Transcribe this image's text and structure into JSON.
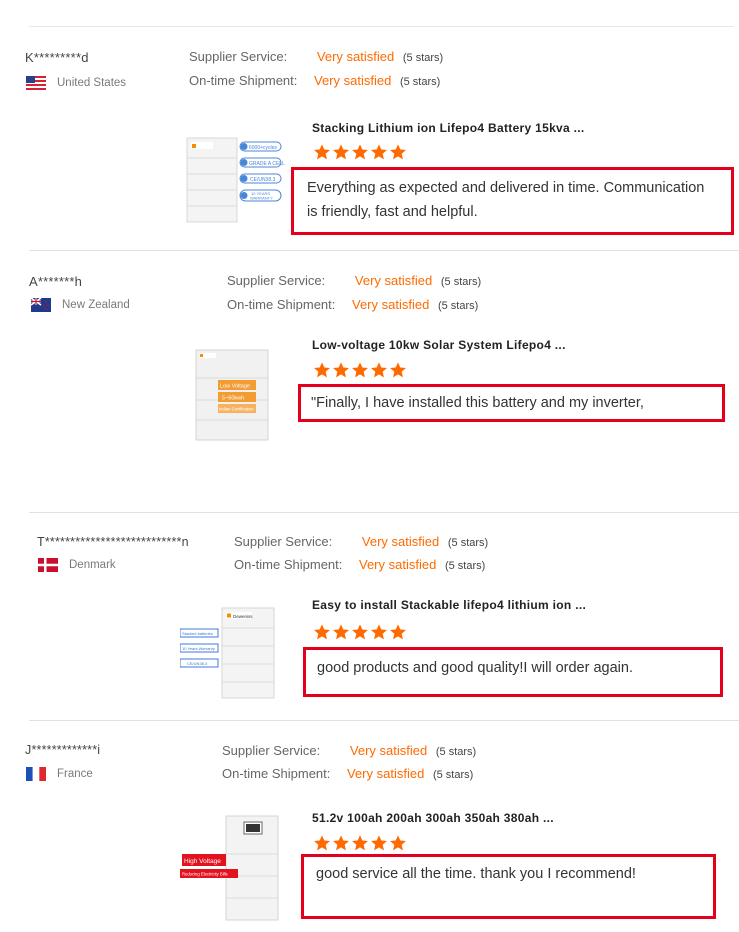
{
  "labels": {
    "supplier_service": "Supplier Service:",
    "ontime_shipment": "On-time Shipment:"
  },
  "colors": {
    "accent": "#ff6a00",
    "highlight_border": "#e4001a"
  },
  "reviews": [
    {
      "user": "K*********d",
      "country": "United States",
      "flag_icon": "us-flag-icon",
      "supplier_service": "Very satisfied",
      "supplier_service_count": "(5 stars)",
      "ontime_shipment": "Very satisfied",
      "ontime_shipment_count": "(5 stars)",
      "product_title": "Stacking Lithium ion Lifepo4 Battery 15kva ...",
      "rating": 5,
      "thumb_badges": [
        "6000+cycles",
        "GRADE A CELL",
        "CE/UN38.3",
        "10 YEARS WARRANTY"
      ],
      "thumb_brand": "Deweniss",
      "review_text": "Everything as expected and delivered in time. Communication is friendly, fast and helpful."
    },
    {
      "user": "A*******h",
      "country": "New Zealand",
      "flag_icon": "nz-flag-icon",
      "supplier_service": "Very satisfied",
      "supplier_service_count": "(5 stars)",
      "ontime_shipment": "Very satisfied",
      "ontime_shipment_count": "(5 stars)",
      "product_title": "Low-voltage 10kw Solar System Lifepo4 ...",
      "rating": 5,
      "thumb_badges": [
        "Low Voltage",
        "5~60kwh",
        "Indian Certification"
      ],
      "review_text": "\"Finally, I have installed this battery and my inverter,"
    },
    {
      "user": "T***************************n",
      "country": "Denmark",
      "flag_icon": "dk-flag-icon",
      "supplier_service": "Very satisfied",
      "supplier_service_count": "(5 stars)",
      "ontime_shipment": "Very satisfied",
      "ontime_shipment_count": "(5 stars)",
      "product_title": "Easy to install Stackable lifepo4 lithium ion ...",
      "rating": 5,
      "thumb_badges": [
        "Stacked batteries",
        "10 Years Warranty",
        "CE/UN38.3"
      ],
      "thumb_brand": "Deweniss",
      "review_text": "good products and good quality!I will order again."
    },
    {
      "user": "J*************i",
      "country": "France",
      "flag_icon": "fr-flag-icon",
      "supplier_service": "Very satisfied",
      "supplier_service_count": "(5 stars)",
      "ontime_shipment": "Very satisfied",
      "ontime_shipment_count": "(5 stars)",
      "product_title": "51.2v 100ah 200ah 300ah 350ah 380ah ...",
      "rating": 5,
      "thumb_badges": [
        "High Voltage",
        "Reducing Electricity Bills"
      ],
      "review_text": "good service all the time. thank you I recommend!"
    }
  ]
}
